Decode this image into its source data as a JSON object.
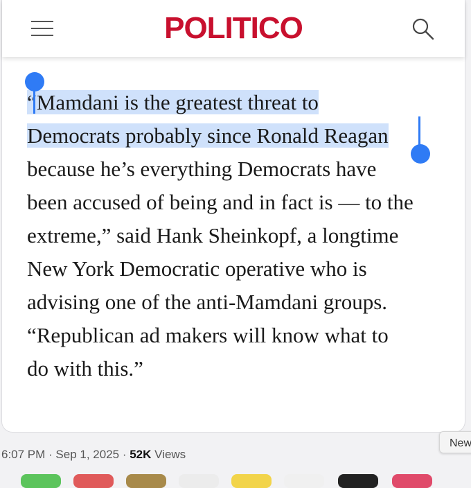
{
  "header": {
    "logo_text": "POLITICO",
    "menu_icon": "hamburger-menu-icon",
    "search_icon": "search-icon"
  },
  "article": {
    "highlighted_lines": [
      "“Mamdani is the greatest threat to",
      "Democrats probably since Ronald Reagan"
    ],
    "lines": [
      "because he’s everything Democrats have",
      "been accused of being and in fact is — to the",
      "extreme,” said Hank Sheinkopf, a longtime",
      "New York Democratic operative who is",
      "advising one of the anti-Mamdani groups.",
      "“Republican ad makers will know what to",
      "do with this.”"
    ]
  },
  "footer": {
    "timestamp": "6:07 PM · Sep 1, 2025 · ",
    "views_count": "52K",
    "views_label": " Views",
    "new_chip": "New"
  },
  "colors": {
    "brand": "#c8102e",
    "selection": "#cfe1fb",
    "handle": "#2f7bf5"
  }
}
